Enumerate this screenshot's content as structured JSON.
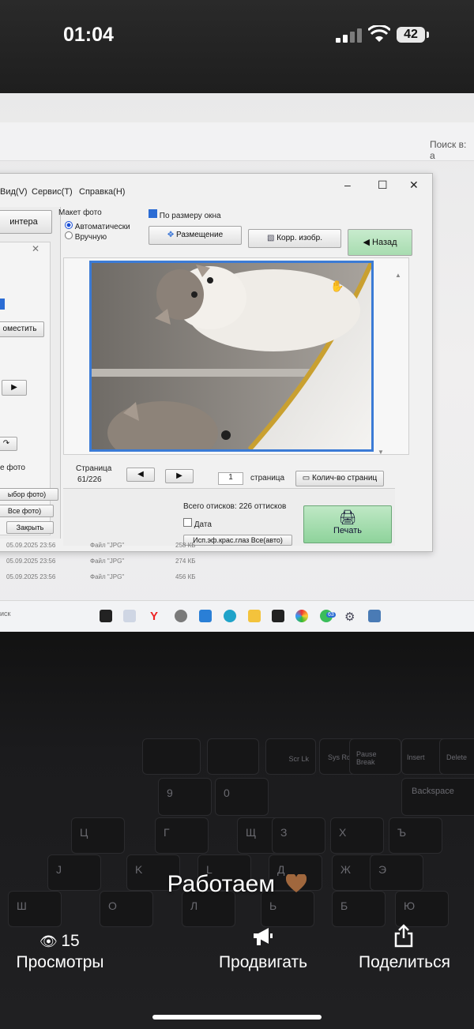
{
  "status_bar": {
    "time": "01:04",
    "battery_level": "42"
  },
  "browser": {
    "search_hint": "Поиск в: а"
  },
  "window": {
    "menu": [
      "Вид(V)",
      "Сервис(T)",
      "Справка(H)"
    ],
    "left_panel": {
      "printer_button": "интера",
      "place_button": "оместить",
      "photo_label": "е фото",
      "select_photo": "ыбор фото)",
      "all_photos": "Все фото)",
      "close_button": "Закрыть"
    },
    "layout_group": {
      "title": "Макет фото",
      "auto": "Автоматически",
      "manual": "Вручную"
    },
    "fit_window": "По размеру окна",
    "placement_button": "Размещение",
    "correct_button": "Корр. изобр.",
    "back_button": "Назад",
    "page": {
      "label": "Страница",
      "value": "61/226",
      "copies": "1",
      "copies_suffix": "страница",
      "count_button": "Колич-во страниц"
    },
    "total": {
      "label": "Всего отисков:",
      "value": "226",
      "unit": "оттисков"
    },
    "date_label": "Дата",
    "red_eye": "Исп.эф.крас.глаз Все(авто)",
    "print_button": "Печать"
  },
  "file_list": [
    {
      "date": "05.09.2025 23:56",
      "type": "Файл \"JPG\"",
      "size": "258 КБ"
    },
    {
      "date": "05.09.2025 23:56",
      "type": "Файл \"JPG\"",
      "size": "274 КБ"
    },
    {
      "date": "05.09.2025 23:56",
      "type": "Файл \"JPG\"",
      "size": "456 КБ"
    }
  ],
  "taskbar": {
    "search": "иск",
    "badge": "63"
  },
  "keyboard": {
    "keys": [
      "Scr Lk",
      "Pause Break",
      "Insert",
      "Delete",
      "Backspace",
      "Sys Rq",
      "9",
      "0",
      "Щ",
      "З",
      "Х",
      "Ъ",
      "J",
      "K",
      "L",
      "Д",
      "Ж",
      "Э",
      "Ш",
      "Г",
      "Ц",
      "О",
      "Л",
      "Ь",
      "Б",
      "Ю"
    ]
  },
  "story": {
    "caption": "Работаем",
    "views_count": "15",
    "views_label": "Просмотры",
    "promote_label": "Продвигать",
    "share_label": "Поделиться"
  },
  "colors": {
    "accent": "#3b7bd6",
    "print_button": "#8ed39b",
    "back_button": "#a8dcb0"
  }
}
